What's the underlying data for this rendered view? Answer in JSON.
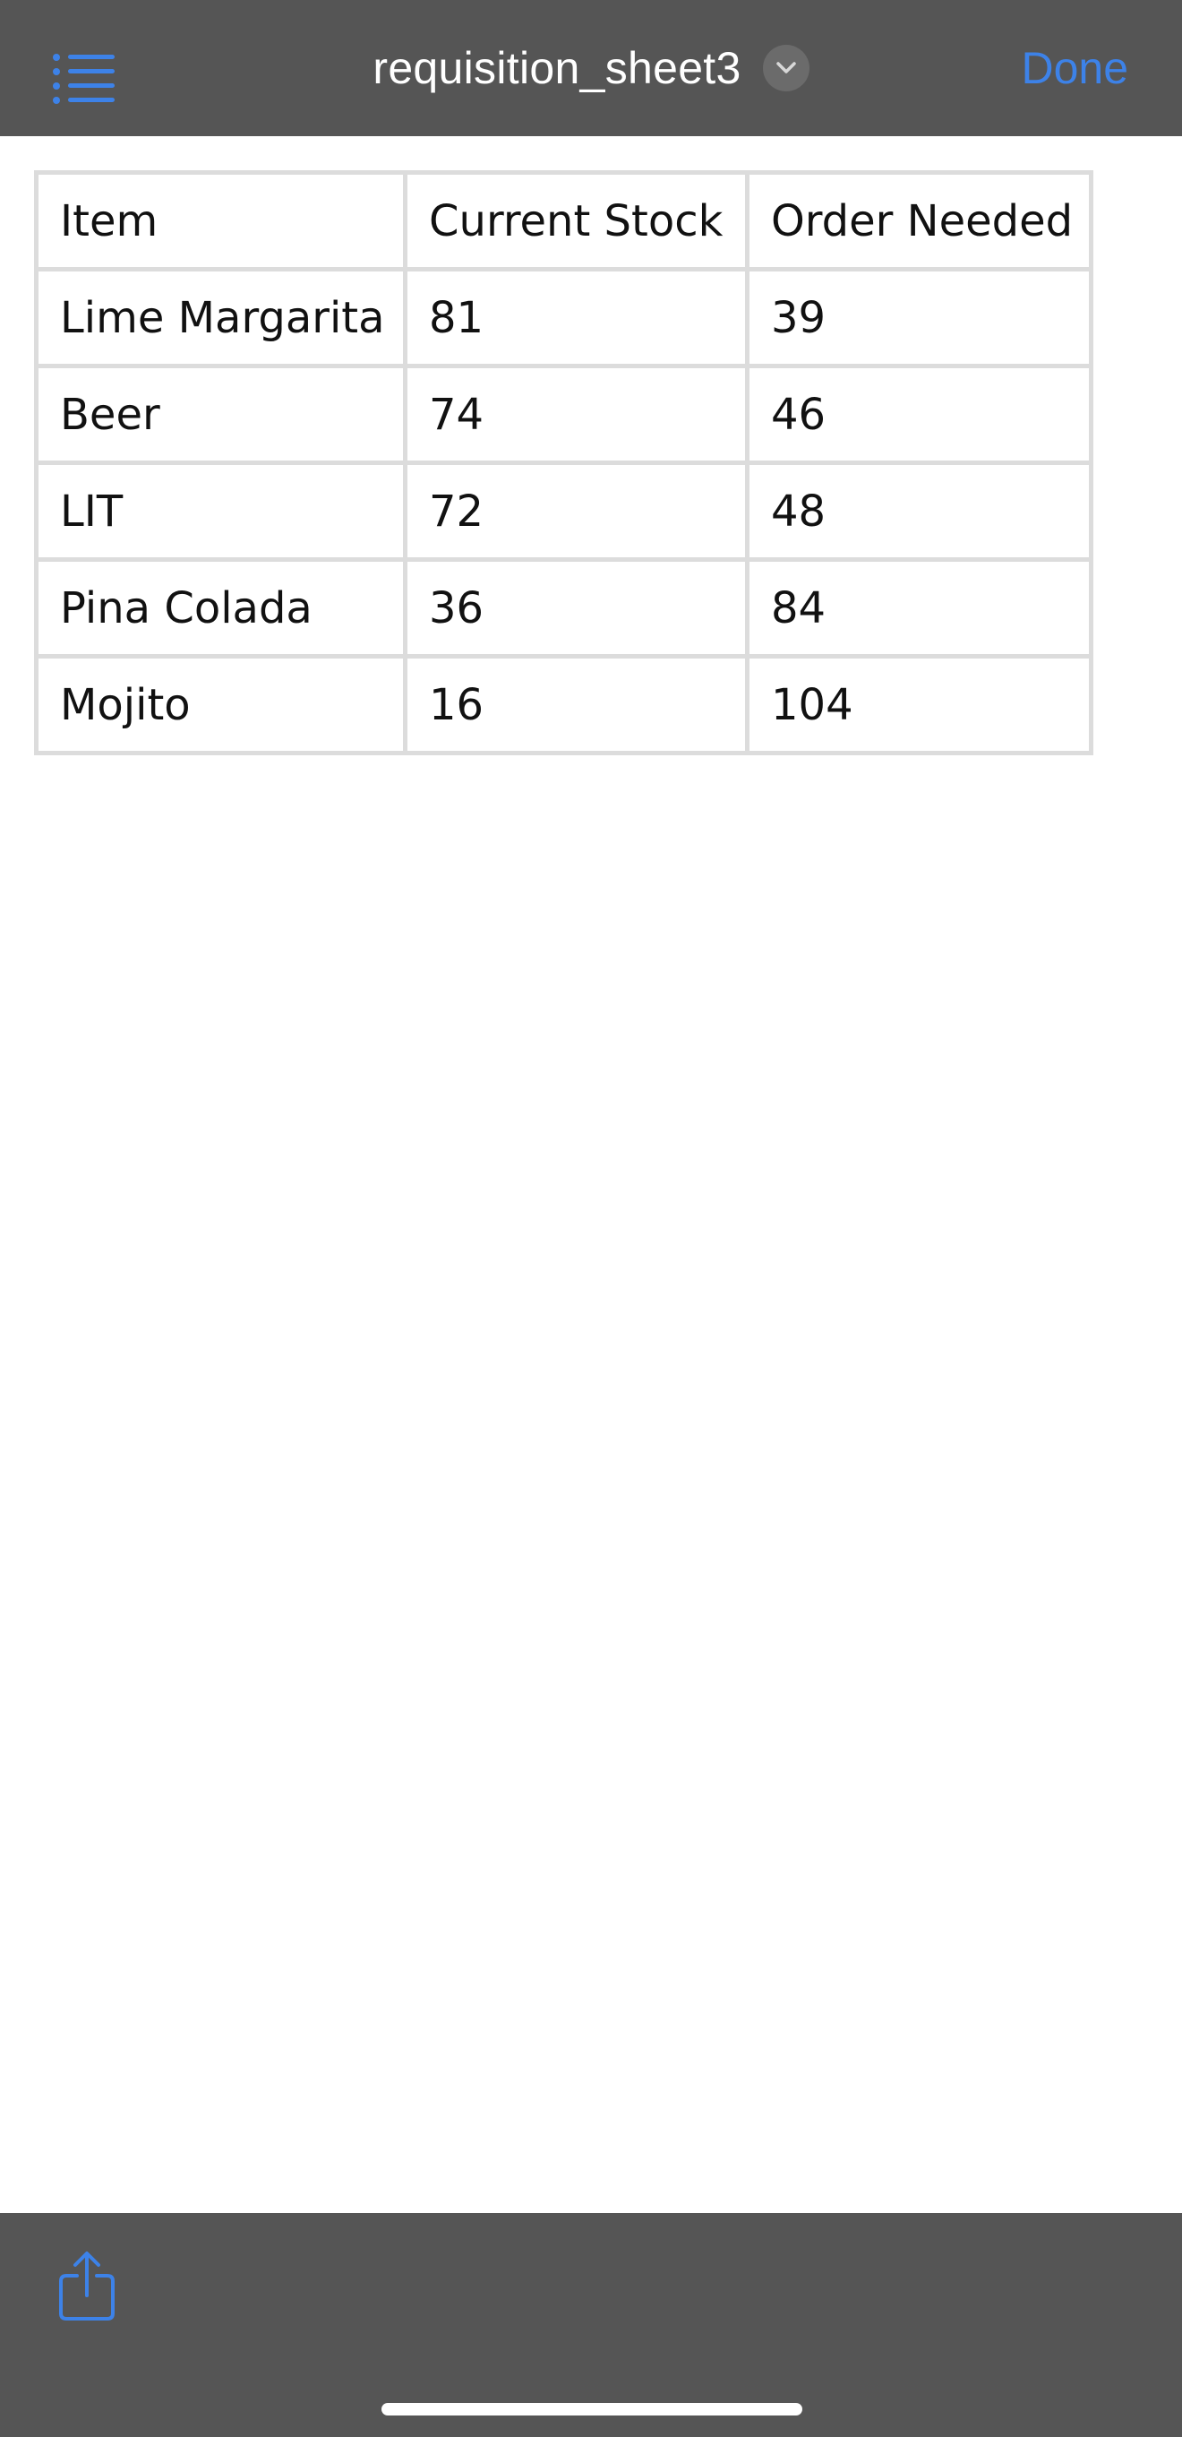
{
  "header": {
    "title": "requisition_sheet3",
    "done_label": "Done",
    "list_icon": "list-icon",
    "dropdown_icon": "chevron-down-icon"
  },
  "table": {
    "rows": [
      [
        "Item",
        "Current Stock",
        "Order Needed"
      ],
      [
        "Lime Margarita",
        "81",
        "39"
      ],
      [
        "Beer",
        "74",
        "46"
      ],
      [
        "LIT",
        "72",
        "48"
      ],
      [
        "Pina Colada",
        "36",
        "84"
      ],
      [
        "Mojito",
        "16",
        "104"
      ]
    ]
  },
  "footer": {
    "share_icon": "share-icon"
  },
  "colors": {
    "bar_background": "#555555",
    "accent": "#3d82e8",
    "grid_lines": "#dcdcdc"
  }
}
